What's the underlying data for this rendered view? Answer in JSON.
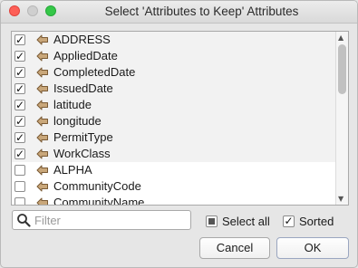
{
  "window": {
    "title": "Select 'Attributes to Keep' Attributes"
  },
  "attributes": [
    {
      "label": "ADDRESS",
      "checked": true,
      "checkmark": "✓"
    },
    {
      "label": "AppliedDate",
      "checked": true,
      "checkmark": "✓"
    },
    {
      "label": "CompletedDate",
      "checked": true,
      "checkmark": "✓"
    },
    {
      "label": "IssuedDate",
      "checked": true,
      "checkmark": "✓"
    },
    {
      "label": "latitude",
      "checked": true,
      "checkmark": "✓"
    },
    {
      "label": "longitude",
      "checked": true,
      "checkmark": "✓"
    },
    {
      "label": "PermitType",
      "checked": true,
      "checkmark": "✓"
    },
    {
      "label": "WorkClass",
      "checked": true,
      "checkmark": "✓"
    },
    {
      "label": "ALPHA",
      "checked": false,
      "checkmark": ""
    },
    {
      "label": "CommunityCode",
      "checked": false,
      "checkmark": ""
    },
    {
      "label": "CommunityName",
      "checked": false,
      "checkmark": ""
    }
  ],
  "filter": {
    "placeholder": "Filter",
    "value": ""
  },
  "options": {
    "select_all": {
      "label": "Select all",
      "state": "mixed"
    },
    "sorted": {
      "label": "Sorted",
      "checked": true,
      "checkmark": "✓"
    }
  },
  "buttons": {
    "cancel": "Cancel",
    "ok": "OK"
  },
  "colors": {
    "arrow_fill": "#c9a77a",
    "arrow_stroke": "#7a5a34",
    "checked_row_bg": "#f2f2f2"
  }
}
